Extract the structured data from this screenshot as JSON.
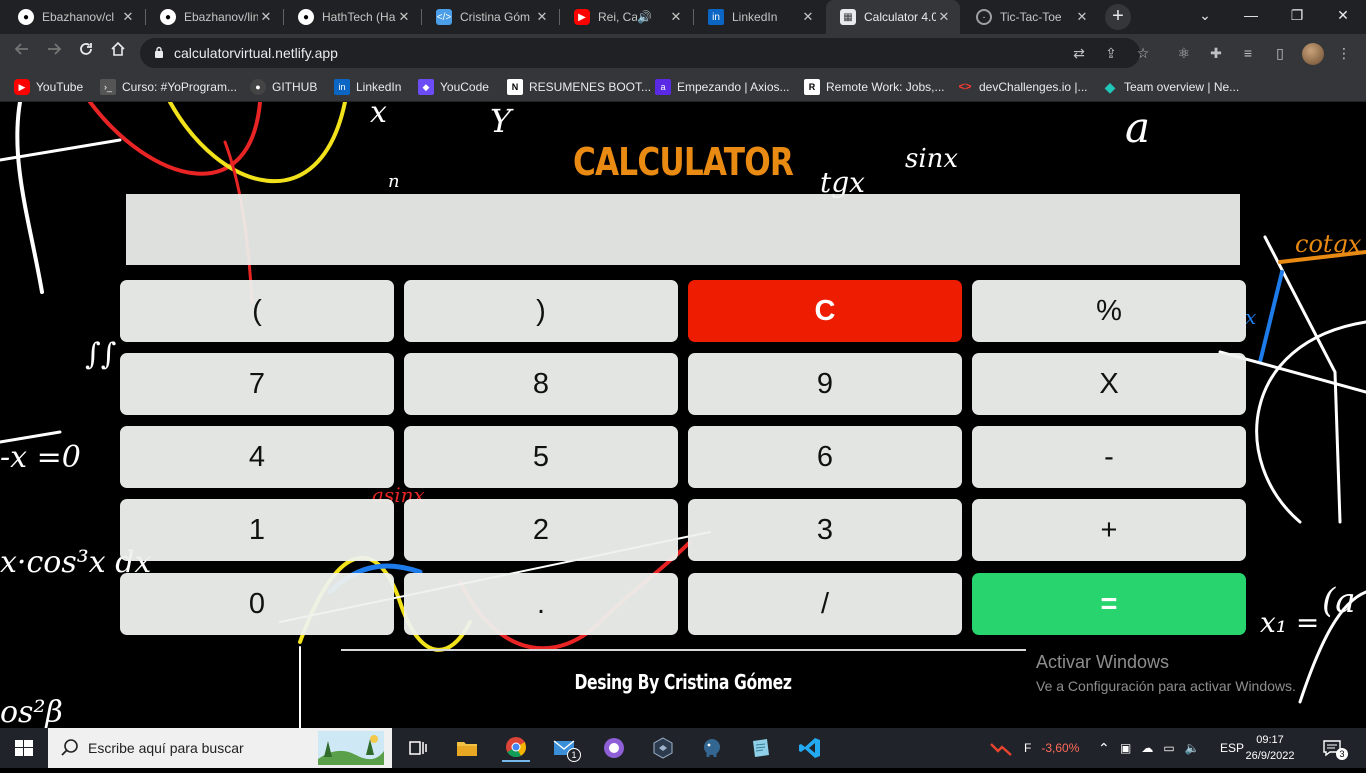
{
  "browser": {
    "tabs": [
      {
        "title": "Ebazhanov/cl",
        "icon": "github-icon"
      },
      {
        "title": "Ebazhanov/lin",
        "icon": "github-icon"
      },
      {
        "title": "HathTech (Ha",
        "icon": "github-icon"
      },
      {
        "title": "Cristina Góm",
        "icon": "code-icon"
      },
      {
        "title": "Rei, Calle",
        "icon": "youtube-icon"
      },
      {
        "title": "LinkedIn",
        "icon": "linkedin-icon"
      },
      {
        "title": "Calculator 4.0",
        "icon": "calculator-icon"
      },
      {
        "title": "Tic-Tac-Toe",
        "icon": "globe-icon"
      }
    ],
    "close_glyph": "✕",
    "new_tab_glyph": "+",
    "url": "calculatorvirtual.netlify.app",
    "window_controls": {
      "dropdown": "⌄",
      "minimize": "—",
      "restore": "❐",
      "close": "✕"
    },
    "bookmarks": [
      {
        "label": "YouTube",
        "icon": "youtube-icon",
        "color": "#ff0000"
      },
      {
        "label": "Curso: #YoProgram...",
        "icon": "terminal-icon",
        "color": "#444444"
      },
      {
        "label": "GITHUB",
        "icon": "github-icon",
        "color": "#444444"
      },
      {
        "label": "LinkedIn",
        "icon": "linkedin-icon",
        "color": "#0a66c2"
      },
      {
        "label": "YouCode",
        "icon": "youcode-icon",
        "color": "#6b4cf6"
      },
      {
        "label": "RESUMENES BOOT...",
        "icon": "notion-icon",
        "color": "#ffffff"
      },
      {
        "label": "Empezando | Axios...",
        "icon": "axios-icon",
        "color": "#5a29e4"
      },
      {
        "label": "Remote Work: Jobs,...",
        "icon": "remote-icon",
        "color": "#ffffff"
      },
      {
        "label": "devChallenges.io |...",
        "icon": "devchallenges-icon",
        "color": "#ff3b30"
      },
      {
        "label": "Team overview | Ne...",
        "icon": "netlify-icon",
        "color": "#20c6b7"
      }
    ]
  },
  "calculator": {
    "title": "CALCULATOR",
    "display_value": "",
    "keys": [
      "(",
      ")",
      "C",
      "%",
      "7",
      "8",
      "9",
      "X",
      "4",
      "5",
      "6",
      "-",
      "1",
      "2",
      "3",
      "+",
      "0",
      ".",
      "/",
      "="
    ],
    "credit": "Desing By Cristina Gómez",
    "colors": {
      "title": "#e98a12",
      "clear": "#ee1c00",
      "equals": "#27d46d",
      "key_bg": "#eef1ee"
    }
  },
  "windows_watermark": {
    "line1": "Activar Windows",
    "line2": "Ve a Configuración para activar Windows."
  },
  "taskbar": {
    "search_placeholder": "Escribe aquí para buscar",
    "stock_label": "F",
    "stock_change": "-3,60%",
    "language": "ESP",
    "time": "09:17",
    "date": "26/9/2022",
    "notifications": "3",
    "mail_badge": "1"
  }
}
